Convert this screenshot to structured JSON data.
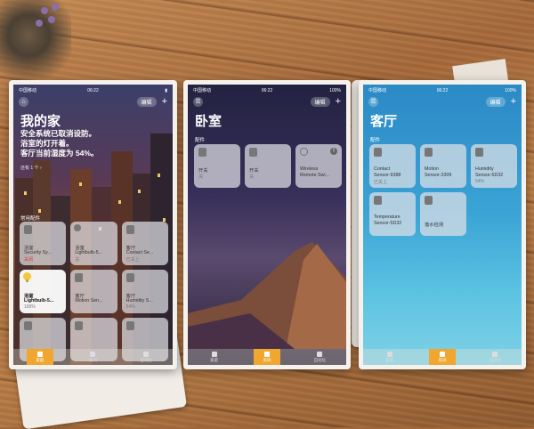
{
  "photo": {
    "table_color": "#a5693b",
    "frame_color": "#f5f2ee"
  },
  "phones": {
    "home": {
      "status": {
        "carrier": "中国移动",
        "time": "06:22"
      },
      "edit_label": "编辑",
      "add_label": "+",
      "title": "我的家",
      "status_line1": "安全系统已取消设防。",
      "status_line2": "浴室的灯开着。",
      "status_line3": "客厅当前湿度为 54%。",
      "more": "还有 1 个 ›",
      "section": "常用配件",
      "tiles": [
        {
          "room": "浴室",
          "name": "Security Sy...",
          "state": "关闭",
          "icon": "security-icon"
        },
        {
          "room": "浴室",
          "name": "Lightbulb-5...",
          "state": "关",
          "icon": "lightbulb-icon"
        },
        {
          "room": "客厅",
          "name": "Contact Se...",
          "state": "已关上",
          "icon": "contact-sensor-icon"
        },
        {
          "room": "浴室",
          "name": "Lightbulb-5...",
          "state": "100%",
          "icon": "lightbulb-icon"
        },
        {
          "room": "客厅",
          "name": "Motion Sen...",
          "state": "",
          "icon": "motion-sensor-icon"
        },
        {
          "room": "客厅",
          "name": "Humidity S...",
          "state": "54%",
          "icon": "humidity-sensor-icon"
        },
        {
          "room": "",
          "name": "",
          "state": ""
        },
        {
          "room": "",
          "name": "",
          "state": ""
        },
        {
          "room": "",
          "name": "",
          "state": ""
        }
      ],
      "tabs": [
        "家庭",
        "房间",
        "自动化"
      ]
    },
    "bedroom": {
      "status": {
        "carrier": "中国移动",
        "time": "06:22",
        "battery": "100%"
      },
      "edit_label": "编辑",
      "add_label": "+",
      "title": "卧室",
      "section": "配件",
      "tiles": [
        {
          "name": "开关",
          "state": "关"
        },
        {
          "name": "开关",
          "state": "关"
        },
        {
          "name": "Wireless",
          "name2": "Remote Swi...",
          "state": ""
        }
      ],
      "tabs": [
        "家庭",
        "房间",
        "自动化"
      ]
    },
    "living": {
      "status": {
        "carrier": "中国移动",
        "time": "06:22",
        "battery": "100%"
      },
      "edit_label": "编辑",
      "add_label": "+",
      "title": "客厅",
      "section": "配件",
      "tiles": [
        {
          "name": "Contact",
          "name2": "Sensor-9388",
          "state": "已关上"
        },
        {
          "name": "Motion",
          "name2": "Sensor-3309",
          "state": ""
        },
        {
          "name": "Humidity",
          "name2": "Sensor-5D32",
          "state": "54%"
        },
        {
          "name": "Temperature",
          "name2": "Sensor-5D32",
          "state": ""
        },
        {
          "name": "落水检测",
          "name2": "",
          "state": ""
        }
      ],
      "tabs": [
        "家庭",
        "房间",
        "自动化"
      ]
    }
  }
}
